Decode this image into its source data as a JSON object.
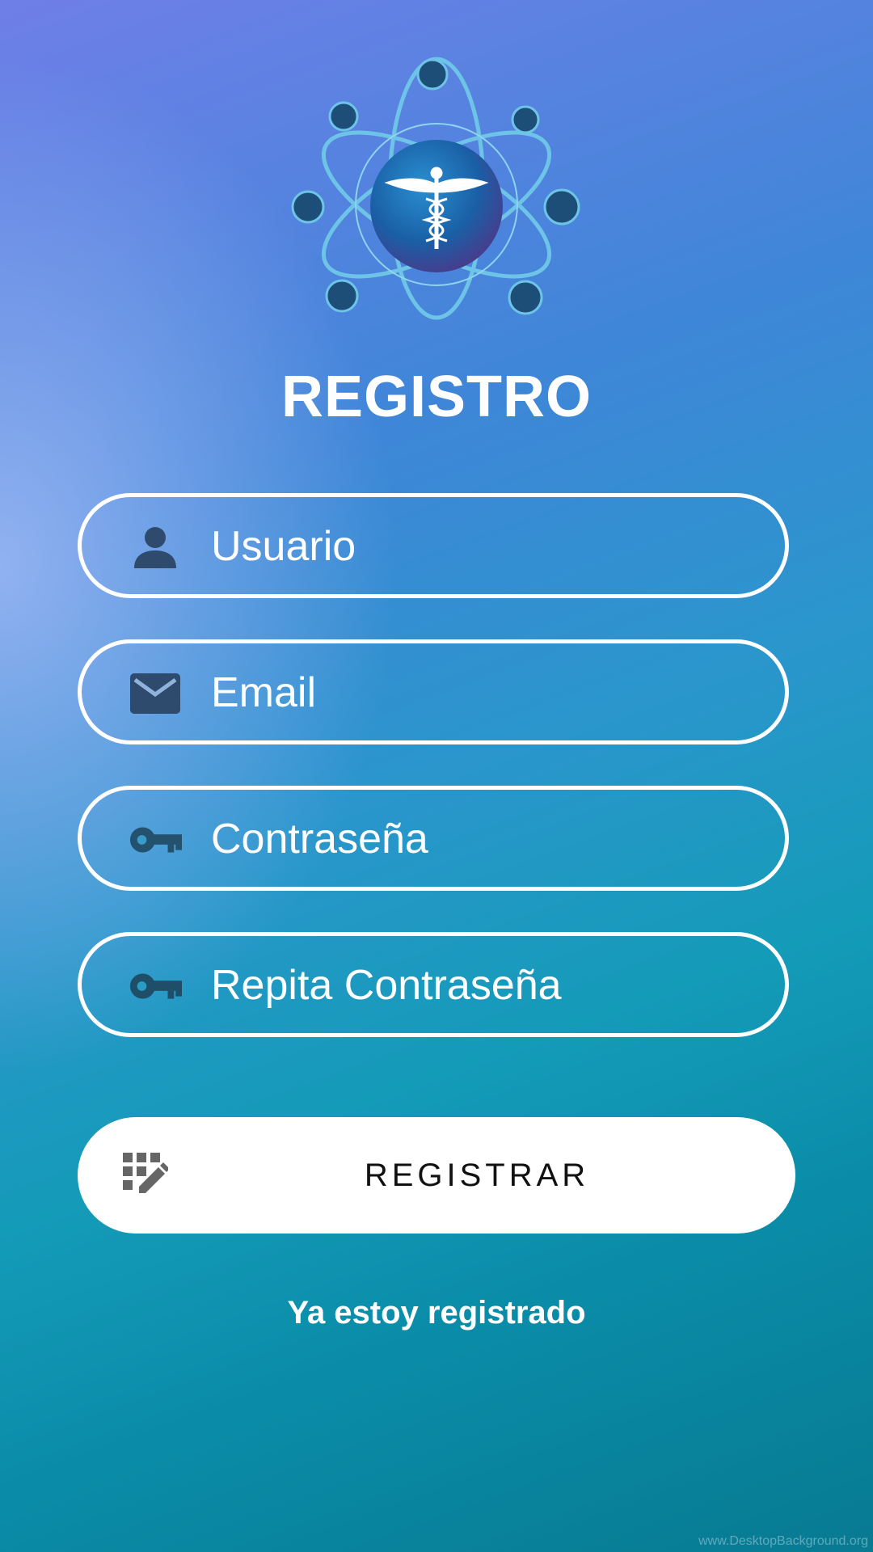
{
  "header": {
    "logo_icon": "atom-caduceus-logo-icon",
    "title": "REGISTRO"
  },
  "form": {
    "fields": [
      {
        "icon": "person-icon",
        "placeholder": "Usuario"
      },
      {
        "icon": "email-icon",
        "placeholder": "Email"
      },
      {
        "icon": "key-icon",
        "placeholder": "Contraseña"
      },
      {
        "icon": "key-icon",
        "placeholder": "Repita Contraseña"
      }
    ],
    "submit_button": {
      "icon": "keypad-edit-icon",
      "label": "REGISTRAR"
    },
    "login_link": "Ya estoy registrado"
  },
  "watermark": "www.DesktopBackground.org",
  "colors": {
    "text": "#ffffff",
    "field_border": "#ffffff",
    "icon": "#2e4b6e",
    "button_bg": "#ffffff",
    "button_text": "#111111"
  }
}
